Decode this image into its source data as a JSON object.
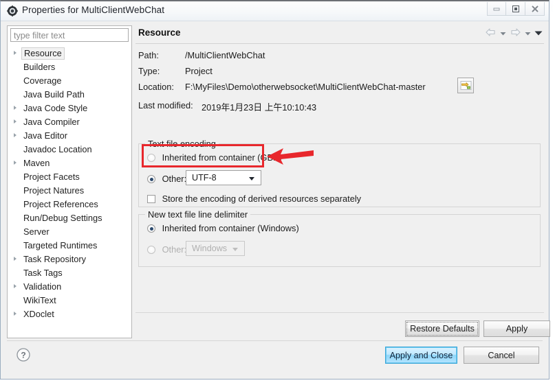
{
  "window": {
    "title": "Properties for MultiClientWebChat",
    "icon": "properties-gear-icon",
    "controls": {
      "minimize": "minimize-icon",
      "restore": "restore-icon",
      "close": "close-icon"
    }
  },
  "sidebar": {
    "filter_placeholder": "type filter text",
    "items": [
      {
        "label": "Resource",
        "expandable": true,
        "selected": true
      },
      {
        "label": "Builders",
        "expandable": false,
        "selected": false
      },
      {
        "label": "Coverage",
        "expandable": false,
        "selected": false
      },
      {
        "label": "Java Build Path",
        "expandable": false,
        "selected": false
      },
      {
        "label": "Java Code Style",
        "expandable": true,
        "selected": false
      },
      {
        "label": "Java Compiler",
        "expandable": true,
        "selected": false
      },
      {
        "label": "Java Editor",
        "expandable": true,
        "selected": false
      },
      {
        "label": "Javadoc Location",
        "expandable": false,
        "selected": false
      },
      {
        "label": "Maven",
        "expandable": true,
        "selected": false
      },
      {
        "label": "Project Facets",
        "expandable": false,
        "selected": false
      },
      {
        "label": "Project Natures",
        "expandable": false,
        "selected": false
      },
      {
        "label": "Project References",
        "expandable": false,
        "selected": false
      },
      {
        "label": "Run/Debug Settings",
        "expandable": false,
        "selected": false
      },
      {
        "label": "Server",
        "expandable": false,
        "selected": false
      },
      {
        "label": "Targeted Runtimes",
        "expandable": false,
        "selected": false
      },
      {
        "label": "Task Repository",
        "expandable": true,
        "selected": false
      },
      {
        "label": "Task Tags",
        "expandable": false,
        "selected": false
      },
      {
        "label": "Validation",
        "expandable": true,
        "selected": false
      },
      {
        "label": "WikiText",
        "expandable": false,
        "selected": false
      },
      {
        "label": "XDoclet",
        "expandable": true,
        "selected": false
      }
    ]
  },
  "page": {
    "title": "Resource",
    "nav": {
      "back": "back-arrow-icon",
      "back_menu": "back-dropdown-icon",
      "forward": "forward-arrow-icon",
      "forward_menu": "forward-dropdown-icon",
      "view_menu": "view-menu-icon"
    },
    "info": {
      "path_label": "Path:",
      "path_value": "/MultiClientWebChat",
      "type_label": "Type:",
      "type_value": "Project",
      "location_label": "Location:",
      "location_value": "F:\\MyFiles\\Demo\\otherwebsocket\\MultiClientWebChat-master",
      "location_button": "browse-location-icon",
      "modified_label": "Last modified:",
      "modified_value": "2019年1月23日 上午10:10:43"
    },
    "encoding_group": {
      "legend": "Text file encoding",
      "inherited_label": "Inherited from container (GBK)",
      "inherited_selected": false,
      "other_label": "Other:",
      "other_selected": true,
      "other_value": "UTF-8",
      "store_derived_label": "Store the encoding of derived resources separately",
      "store_derived_checked": false
    },
    "delimiter_group": {
      "legend": "New text file line delimiter",
      "inherited_label": "Inherited from container (Windows)",
      "inherited_selected": true,
      "other_label": "Other:",
      "other_selected": false,
      "other_value": "Windows",
      "other_disabled": true
    },
    "buttons": {
      "restore_defaults": "Restore Defaults",
      "apply": "Apply"
    }
  },
  "footer": {
    "help": "help-icon",
    "apply_and_close": "Apply and Close",
    "cancel": "Cancel"
  },
  "annotation": {
    "highlight_color": "#e8272c",
    "box": "red-highlight-box",
    "arrow": "red-pointer-arrow"
  }
}
